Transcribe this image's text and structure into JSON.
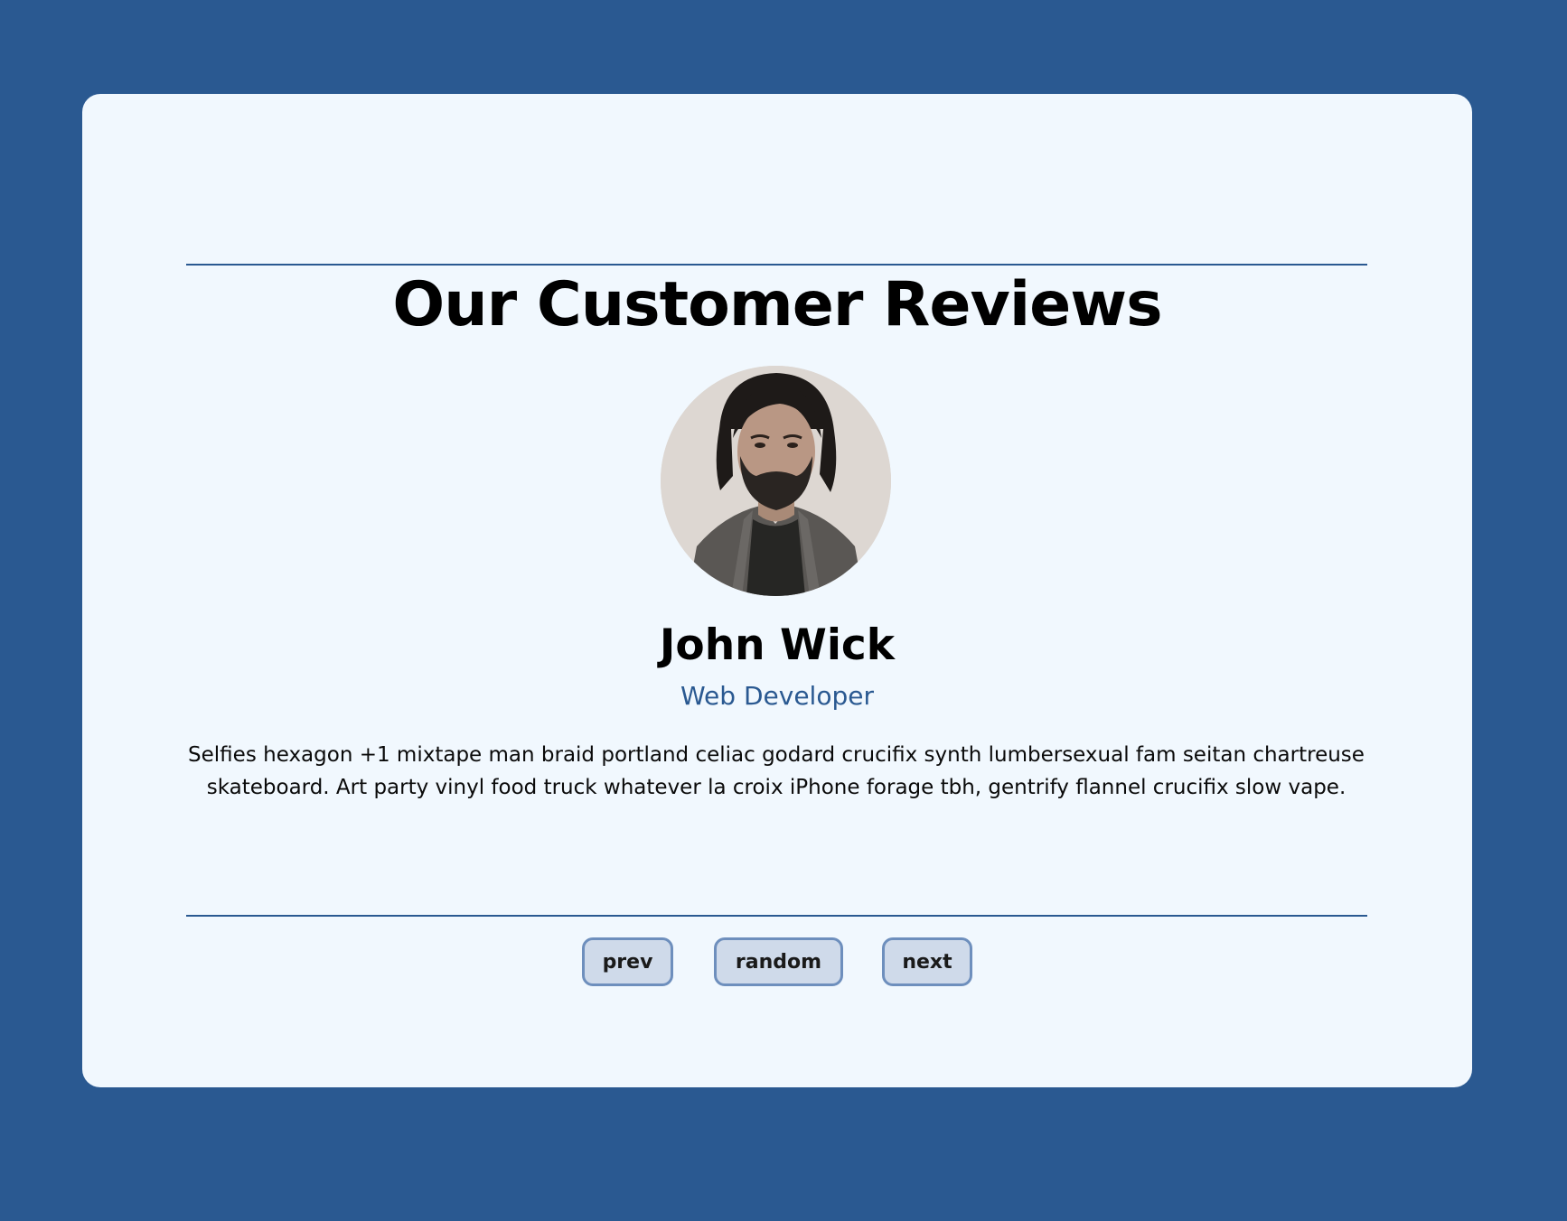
{
  "page": {
    "title": "Our Customer Reviews"
  },
  "review": {
    "name": "John Wick",
    "job": "Web Developer",
    "text": "Selfies hexagon +1 mixtape man braid portland celiac godard crucifix synth lumbersexual fam seitan chartreuse skateboard. Art party vinyl food truck whatever la croix iPhone forage tbh, gentrify flannel crucifix slow vape."
  },
  "buttons": {
    "prev": "prev",
    "random": "random",
    "next": "next"
  },
  "colors": {
    "background": "#2a5991",
    "card": "#f1f8fe",
    "accent": "#2a5991",
    "button_bg": "#cfdaea",
    "button_border": "#6e8fbd"
  }
}
